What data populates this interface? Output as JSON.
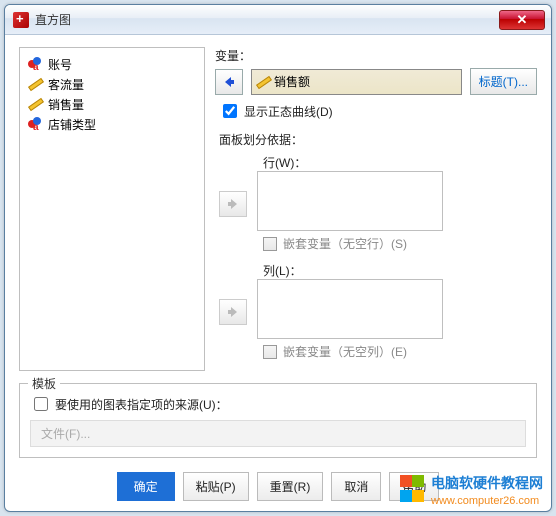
{
  "window": {
    "title": "直方图"
  },
  "source_vars": [
    {
      "label": "账号",
      "icon": "nominal-a"
    },
    {
      "label": "客流量",
      "icon": "scale"
    },
    {
      "label": "销售量",
      "icon": "scale"
    },
    {
      "label": "店铺类型",
      "icon": "nominal-a"
    }
  ],
  "variable": {
    "label": "变量：",
    "value": "销售额",
    "title_button": "标题(T)..."
  },
  "normal_curve": {
    "checked": true,
    "label": "显示正态曲线(D)"
  },
  "panel": {
    "title": "面板划分依据：",
    "row_label": "行(W)：",
    "row_nest": "嵌套变量（无空行）(S)",
    "col_label": "列(L)：",
    "col_nest": "嵌套变量（无空列）(E)"
  },
  "template": {
    "legend": "模板",
    "use_template_label": "要使用的图表指定项的来源(U)：",
    "file_button": "文件(F)..."
  },
  "buttons": {
    "ok": "确定",
    "paste": "粘贴(P)",
    "reset": "重置(R)",
    "cancel": "取消",
    "help": "帮助"
  },
  "watermark": {
    "line1": "电脑软硬件教程网",
    "line2": "www.computer26.com"
  }
}
